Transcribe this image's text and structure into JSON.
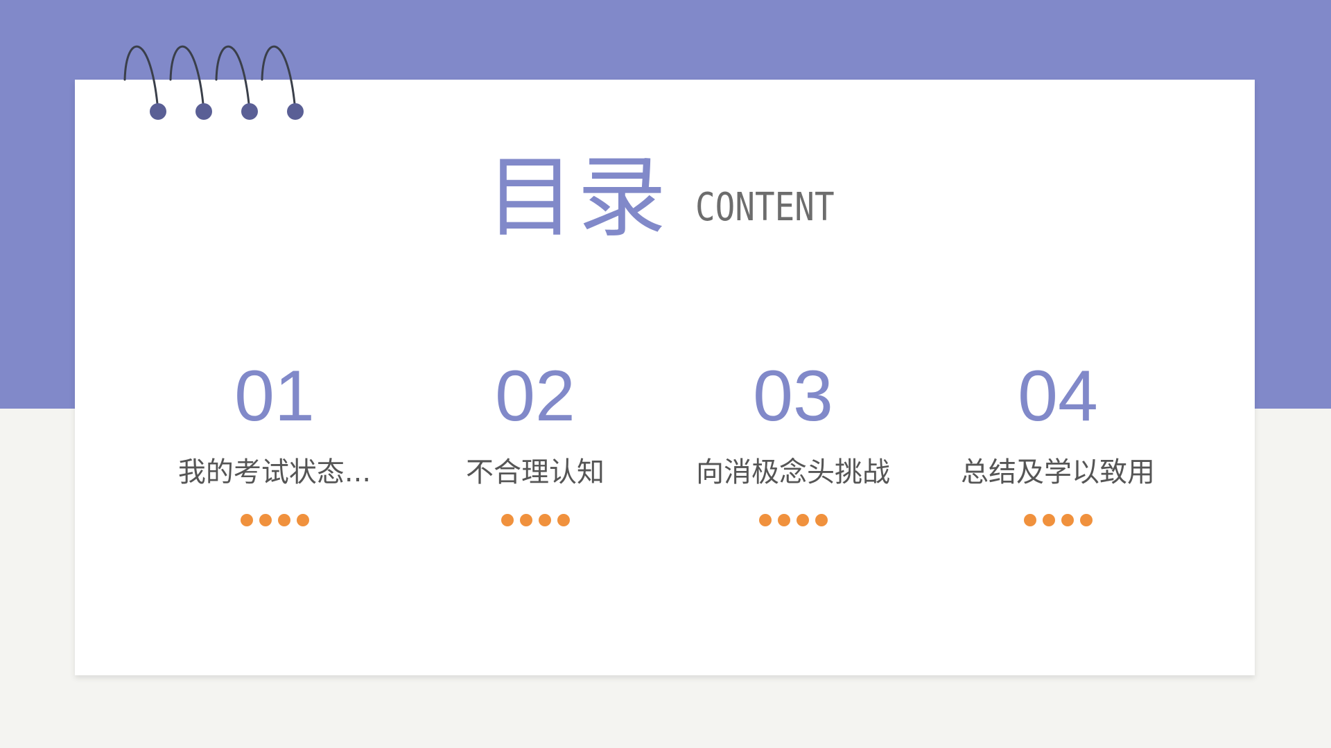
{
  "title": {
    "cn": "目录",
    "en": "CONTENT"
  },
  "items": [
    {
      "number": "01",
      "label": "我的考试状态..."
    },
    {
      "number": "02",
      "label": "不合理认知"
    },
    {
      "number": "03",
      "label": "向消极念头挑战"
    },
    {
      "number": "04",
      "label": "总结及学以致用"
    }
  ],
  "colors": {
    "accent_purple": "#8189c9",
    "dot_orange": "#f0913d",
    "background": "#f4f4f1",
    "card": "#ffffff"
  }
}
